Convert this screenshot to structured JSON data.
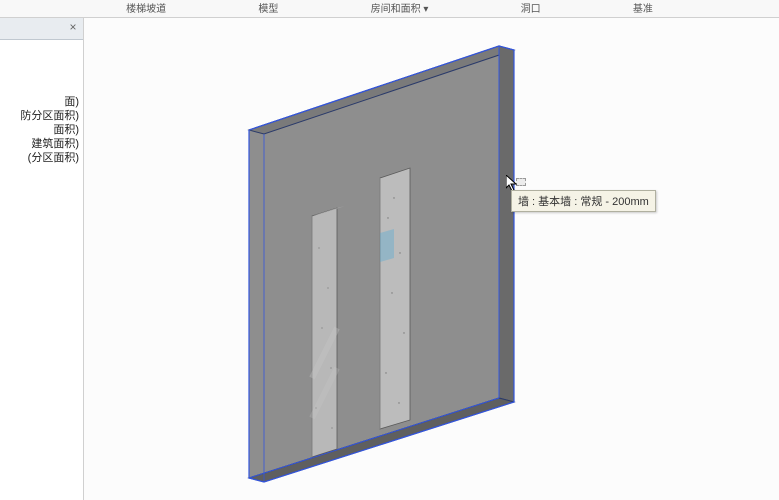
{
  "ribbon": {
    "tabs": [
      "楼梯坡道",
      "模型",
      "房间和面积 ▾",
      "洞口",
      "基准"
    ]
  },
  "side_panel": {
    "items": [
      "面)",
      "防分区面积)",
      "面积)",
      "建筑面积)",
      "(分区面积)"
    ]
  },
  "tooltip": {
    "text": "墙 : 基本墙 : 常规 - 200mm"
  }
}
